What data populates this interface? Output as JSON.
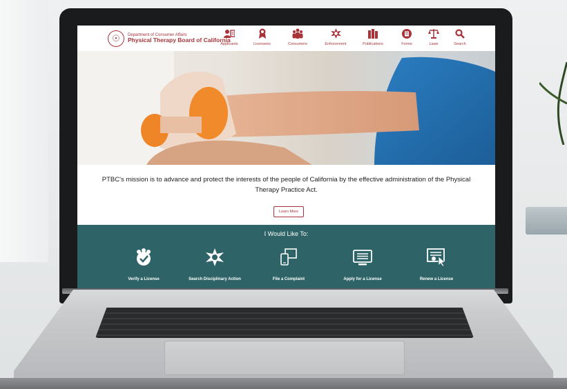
{
  "header": {
    "department": "Department of Consumer Affairs",
    "board": "Physical Therapy Board of California"
  },
  "nav": {
    "items": [
      {
        "label": "Applicants",
        "icon": "applicants-icon"
      },
      {
        "label": "Licensees",
        "icon": "licensees-icon"
      },
      {
        "label": "Consumers",
        "icon": "consumers-icon"
      },
      {
        "label": "Enforcement",
        "icon": "enforcement-icon"
      },
      {
        "label": "Publications",
        "icon": "publications-icon"
      },
      {
        "label": "Forms",
        "icon": "forms-icon"
      },
      {
        "label": "Laws",
        "icon": "laws-icon"
      },
      {
        "label": "Search",
        "icon": "search-icon"
      }
    ]
  },
  "mission": {
    "text": "PTBC's mission is to advance and protect the interests of the people of California by the effective administration of the Physical Therapy Practice Act.",
    "button": "Learn More"
  },
  "actions": {
    "title": "I Would Like To:",
    "items": [
      {
        "label": "Verify a License",
        "icon": "verify-license-icon"
      },
      {
        "label": "Search Disciplinary Action",
        "icon": "disciplinary-badge-icon"
      },
      {
        "label": "File a Complaint",
        "icon": "complaint-devices-icon"
      },
      {
        "label": "Apply for a License",
        "icon": "apply-monitor-icon"
      },
      {
        "label": "Renew a License",
        "icon": "renew-certificate-icon"
      }
    ]
  },
  "colors": {
    "brand": "#a8343a",
    "band": "#2e6467"
  }
}
